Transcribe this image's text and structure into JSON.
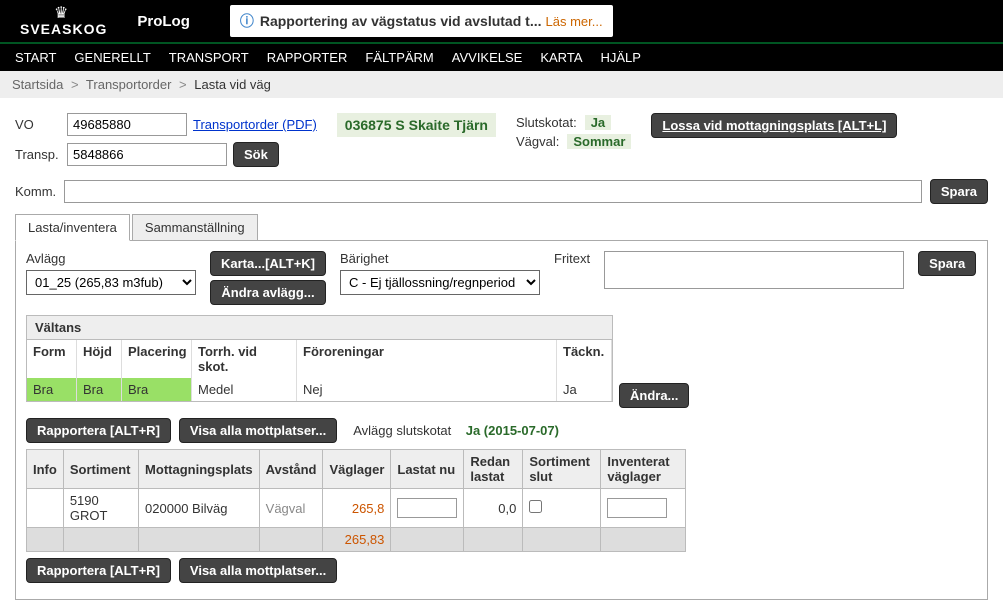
{
  "header": {
    "brand": "SVEASKOG",
    "app": "ProLog",
    "notice": "Rapportering av vägstatus vid avslutad t...",
    "notice_link": "Läs mer..."
  },
  "menu": [
    "START",
    "GENERELLT",
    "TRANSPORT",
    "RAPPORTER",
    "FÄLTPÄRM",
    "AVVIKELSE",
    "KARTA",
    "HJÄLP"
  ],
  "breadcrumb": {
    "a": "Startsida",
    "b": "Transportorder",
    "current": "Lasta vid väg"
  },
  "vo": {
    "label": "VO",
    "value": "49685880"
  },
  "transp": {
    "label": "Transp.",
    "value": "5848866"
  },
  "pdf_link": "Transportorder (PDF)",
  "sok": "Sök",
  "location": "036875 S Skaite Tjärn",
  "status": {
    "slut_label": "Slutskotat:",
    "slut_val": "Ja",
    "vag_label": "Vägval:",
    "vag_val": "Sommar"
  },
  "lossa_btn": "Lossa vid mottagningsplats [ALT+L]",
  "komm_label": "Komm.",
  "komm_value": "",
  "spara": "Spara",
  "tabs": {
    "a": "Lasta/inventera",
    "b": "Sammanställning"
  },
  "controls": {
    "avlagg_label": "Avlägg",
    "avlagg_value": "01_25 (265,83 m3fub)",
    "karta_btn": "Karta...[ALT+K]",
    "andra_avlagg": "Ändra avlägg...",
    "barighet_label": "Bärighet",
    "barighet_value": "C - Ej tjällossning/regnperiod",
    "fritext_label": "Fritext",
    "fritext_value": "",
    "spara": "Spara"
  },
  "valtans": {
    "title": "Vältans",
    "headers": {
      "form": "Form",
      "hojd": "Höjd",
      "plac": "Placering",
      "torrh": "Torrh. vid skot.",
      "foro": "Föroreningar",
      "tack": "Täckn."
    },
    "row": {
      "form": "Bra",
      "hojd": "Bra",
      "plac": "Bra",
      "torrh": "Medel",
      "foro": "Nej",
      "tack": "Ja"
    },
    "andra": "Ändra..."
  },
  "actions": {
    "rapportera": "Rapportera [ALT+R]",
    "visa": "Visa alla mottplatser...",
    "avlagg_slut": "Avlägg slutskotat",
    "avlagg_date": "Ja (2015-07-07)"
  },
  "table": {
    "headers": {
      "info": "Info",
      "sortiment": "Sortiment",
      "mott": "Mottagningsplats",
      "avstand": "Avstånd",
      "vaglager": "Väglager",
      "lastat": "Lastat nu",
      "redan": "Redan lastat",
      "slut": "Sortiment slut",
      "inv": "Inventerat väglager"
    },
    "rows": [
      {
        "info": "",
        "sortiment": "5190 GROT",
        "mott": "020000 Bilväg",
        "avstand": "Vägval",
        "vaglager": "265,8",
        "lastat": "",
        "redan": "0,0",
        "slut": false,
        "inv": ""
      }
    ],
    "sum_vaglager": "265,83"
  },
  "bottom_actions": {
    "rapportera": "Rapportera [ALT+R]",
    "visa": "Visa alla mottplatser..."
  }
}
